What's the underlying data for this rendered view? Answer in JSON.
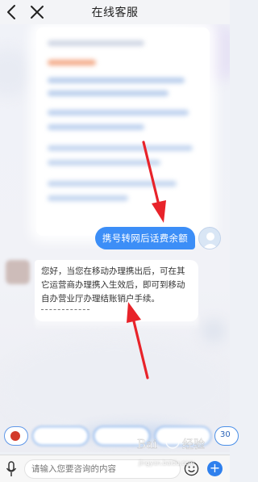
{
  "header": {
    "title": "在线客服"
  },
  "messages": {
    "outgoing": {
      "text": "携号转网后话费余额"
    },
    "incoming": {
      "text": "您好，当您在移动办理携出后，可在其它运营商办理携入生效后，即可到移动自办营业厅办理结账销户手续。"
    }
  },
  "quick_replies": {
    "last_label": "30"
  },
  "input_bar": {
    "placeholder": "请输入您要咨询的内容"
  },
  "watermark": {
    "logo": "Bai度经验",
    "url": "jingyan.baidu.com"
  },
  "icons": {
    "back": "back-icon",
    "close": "close-icon",
    "mic": "microphone-icon",
    "emoji": "emoji-icon",
    "plus": "plus-icon"
  },
  "colors": {
    "accent": "#3c8ef7",
    "arrow": "#e8232a",
    "background": "#eef1f6"
  }
}
